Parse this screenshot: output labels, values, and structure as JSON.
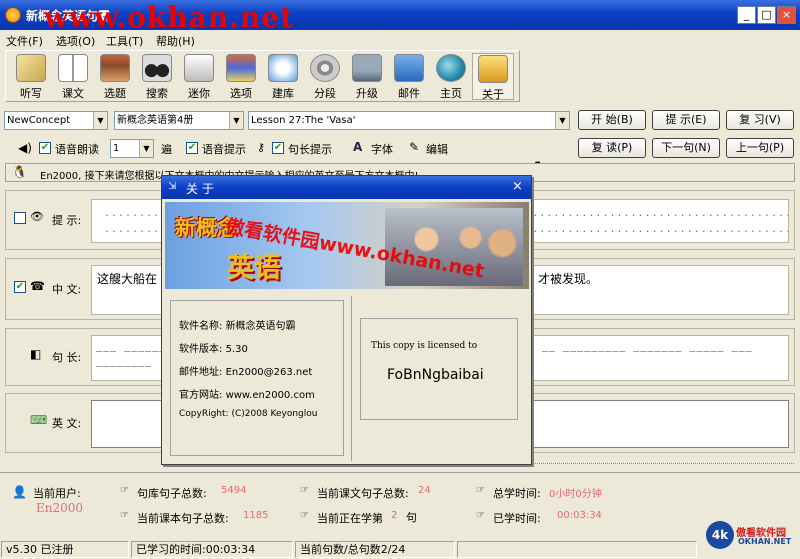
{
  "window": {
    "title": "新概念英语句霸",
    "watermark": "www.okhan.net",
    "min_glyph": "_",
    "max_glyph": "□",
    "close_glyph": "×"
  },
  "menu": [
    "文件(F)",
    "选项(O)",
    "工具(T)",
    "帮助(H)"
  ],
  "toolbar": [
    {
      "label": "听写",
      "icon": "pencil-icon"
    },
    {
      "label": "课文",
      "icon": "book-icon"
    },
    {
      "label": "选题",
      "icon": "books-icon"
    },
    {
      "label": "搜索",
      "icon": "binoculars-icon"
    },
    {
      "label": "迷你",
      "icon": "printer-icon"
    },
    {
      "label": "选项",
      "icon": "stack-icon"
    },
    {
      "label": "建库",
      "icon": "move-icon"
    },
    {
      "label": "分段",
      "icon": "filmreel-icon"
    },
    {
      "label": "升级",
      "icon": "computer-icon"
    },
    {
      "label": "邮件",
      "icon": "mail-icon"
    },
    {
      "label": "主页",
      "icon": "globe-icon"
    },
    {
      "label": "关于",
      "icon": "about-icon"
    }
  ],
  "selectors": {
    "source": "NewConcept",
    "book": "新概念英语第4册",
    "lesson": "Lesson 27:The 'Vasa'"
  },
  "buttons_row1": {
    "start": "开 始(B)",
    "hint": "提 示(E)",
    "review": "复 习(V)"
  },
  "options": {
    "read_aloud": "语音朗读",
    "repeat_count": "1",
    "times": "遍",
    "voice_hint": "语音提示",
    "sentence_hint": "句长提示",
    "font": "字体",
    "edit": "编辑"
  },
  "buttons_row2": {
    "reread": "复 读(P)",
    "next": "下一句(N)",
    "prev": "上一句(P)"
  },
  "tip": "En2000, 接下来请您根据以下文本框中的中文提示输入相应的英文至最下方文本框中!",
  "sections": {
    "hint": {
      "label": "提 示:",
      "dots": "..................................................................................................................................."
    },
    "chinese": {
      "label": "中 文:",
      "text": "这艘大船在",
      "tail": "才被发现。"
    },
    "length": {
      "label": "句 长:",
      "dashes": "___ ______",
      "dashes_right": "__ _________ _______ _____ ___",
      "dashes2": "________"
    },
    "english": {
      "label": "英 文:"
    }
  },
  "dialog": {
    "title": "关 于",
    "banner_text1": "新概念",
    "banner_text2": "英语",
    "overlay_watermark": "傲看软件园www.okhan.net",
    "info": [
      {
        "k": "软件名称:",
        "v": "新概念英语句霸"
      },
      {
        "k": "软件版本:",
        "v": "5.30"
      },
      {
        "k": "邮件地址:",
        "v": "En2000@263.net"
      },
      {
        "k": "官方网站:",
        "v": "www.en2000.com"
      },
      {
        "k": "CopyRight:",
        "v": "(C)2008 Keyonglou"
      }
    ],
    "license_label": "This copy is licensed to",
    "license_name": "FoBnNgbaibai"
  },
  "stats": {
    "current_user_label": "当前用户:",
    "current_user": "En2000",
    "total_sentences_label": "句库句子总数:",
    "total_sentences": "5494",
    "lesson_sentences_label": "当前课文句子总数:",
    "lesson_sentences": "24",
    "total_time_label": "总学时间:",
    "total_time": "0小时0分钟",
    "book_sentences_label": "当前课本句子总数:",
    "book_sentences": "1185",
    "current_no_label": "当前正在学第",
    "current_no": "2",
    "current_no_unit": "句",
    "studied_label": "已学时间:",
    "studied_time": "00:03:34"
  },
  "statusbar": {
    "version": "v5.30 已注册",
    "studied": "已学习的时间:00:03:34",
    "progress": "当前句数/总句数2/24"
  },
  "logo": {
    "mark": "4k",
    "text_top": "傲看软件园",
    "text_bottom": "OKHAN.NET"
  },
  "colors": {
    "title_blue": "#0b3fc4",
    "watermark_red": "#ee0000",
    "stat_value": "#e06a7a"
  }
}
